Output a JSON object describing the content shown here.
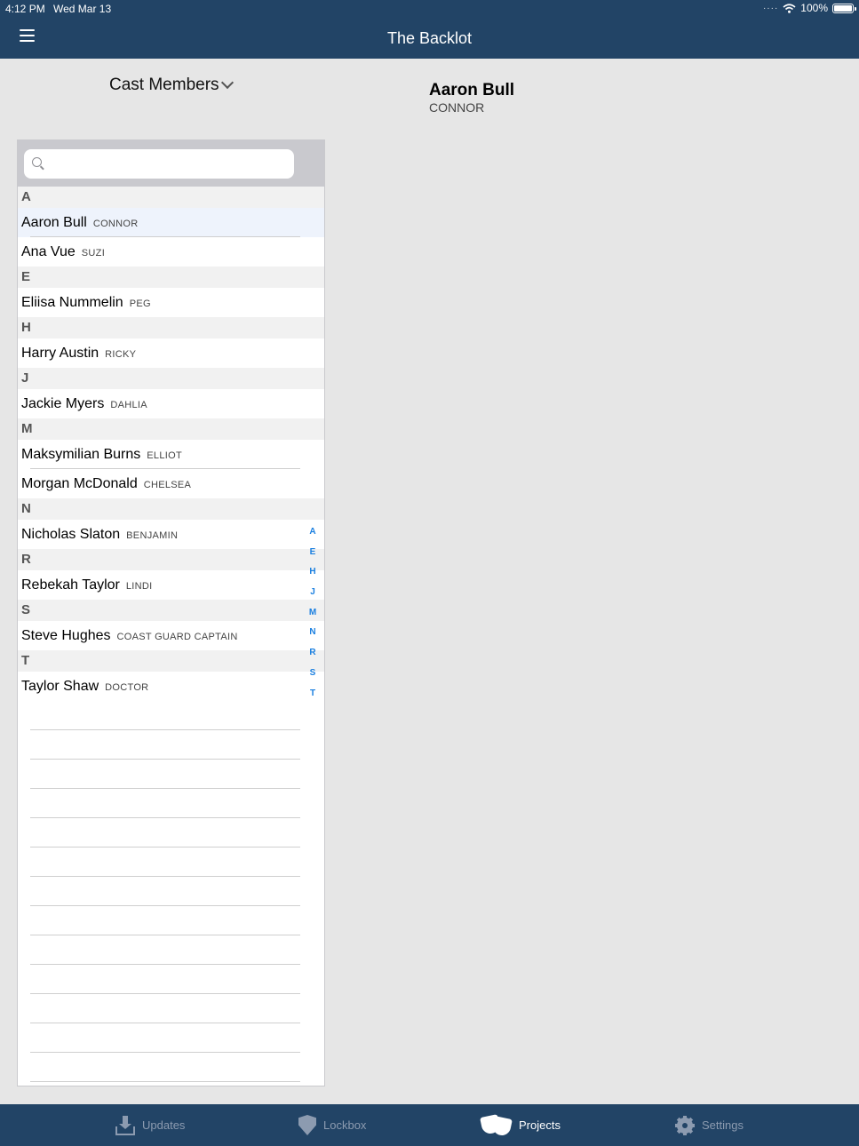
{
  "status": {
    "time": "4:12 PM",
    "date": "Wed Mar 13",
    "battery": "100%",
    "battery_level": 1.0
  },
  "header": {
    "title": "The Backlot"
  },
  "selector": {
    "label": "Cast Members"
  },
  "detail": {
    "name": "Aaron Bull",
    "role": "CONNOR"
  },
  "search": {
    "placeholder": ""
  },
  "sections": [
    {
      "letter": "A",
      "rows": [
        {
          "name": "Aaron Bull",
          "role": "CONNOR",
          "selected": true
        },
        {
          "name": "Ana Vue",
          "role": "SUZI"
        }
      ]
    },
    {
      "letter": "E",
      "rows": [
        {
          "name": "Eliisa Nummelin",
          "role": "PEG"
        }
      ]
    },
    {
      "letter": "H",
      "rows": [
        {
          "name": "Harry Austin",
          "role": "RICKY"
        }
      ]
    },
    {
      "letter": "J",
      "rows": [
        {
          "name": "Jackie Myers",
          "role": "DAHLIA"
        }
      ]
    },
    {
      "letter": "M",
      "rows": [
        {
          "name": "Maksymilian Burns",
          "role": "ELLIOT"
        },
        {
          "name": "Morgan McDonald",
          "role": "CHELSEA"
        }
      ]
    },
    {
      "letter": "N",
      "rows": [
        {
          "name": "Nicholas Slaton",
          "role": "BENJAMIN"
        }
      ]
    },
    {
      "letter": "R",
      "rows": [
        {
          "name": "Rebekah Taylor",
          "role": "LINDI"
        }
      ]
    },
    {
      "letter": "S",
      "rows": [
        {
          "name": "Steve Hughes",
          "role": "COAST GUARD CAPTAIN"
        }
      ]
    },
    {
      "letter": "T",
      "rows": [
        {
          "name": "Taylor Shaw",
          "role": "DOCTOR"
        }
      ]
    }
  ],
  "index": [
    "A",
    "E",
    "H",
    "J",
    "M",
    "N",
    "R",
    "S",
    "T"
  ],
  "tabs": [
    {
      "label": "Updates",
      "icon": "updates-icon",
      "active": false
    },
    {
      "label": "Lockbox",
      "icon": "shield-icon",
      "active": false
    },
    {
      "label": "Projects",
      "icon": "theater-masks-icon",
      "active": true
    },
    {
      "label": "Settings",
      "icon": "gear-icon",
      "active": false
    }
  ],
  "colors": {
    "nav_bar": "#224466",
    "index_accent": "#1a7fe0",
    "tab_inactive": "#8c9bb0",
    "selected_row": "#eef3fc"
  }
}
